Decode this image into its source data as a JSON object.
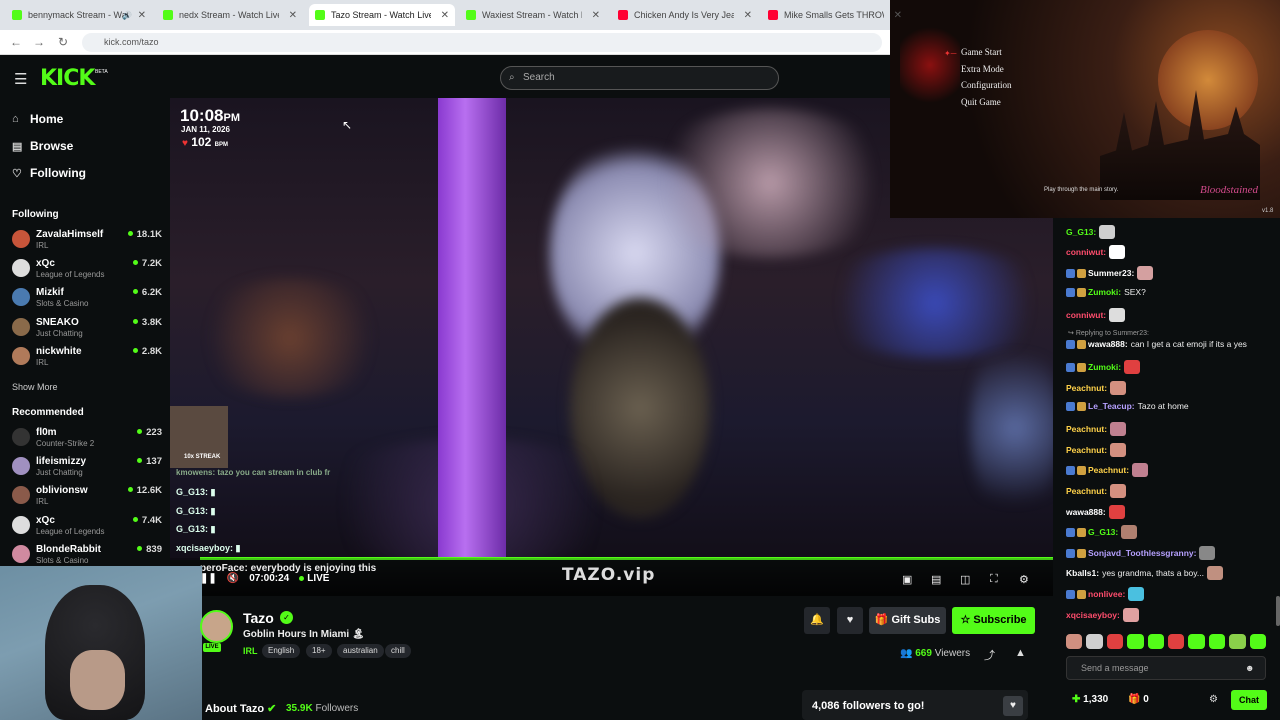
{
  "browser": {
    "tabs": [
      {
        "title": "bennymack Stream - Watch Live on",
        "color": "#53fc18",
        "active": false,
        "muted": true
      },
      {
        "title": "nedx Stream - Watch Live on Kick",
        "color": "#53fc18",
        "active": false
      },
      {
        "title": "Tazo Stream - Watch Live on Kick",
        "color": "#53fc18",
        "active": true
      },
      {
        "title": "Waxiest Stream - Watch Live on Kick",
        "color": "#53fc18",
        "active": false
      },
      {
        "title": "Chicken Andy Is Very Jealous",
        "color": "#ff0033",
        "active": false
      },
      {
        "title": "Mike Smalls Gets THROWN",
        "color": "#ff0033",
        "active": false
      }
    ],
    "url": "kick.com/tazo"
  },
  "header": {
    "logo": "KICK",
    "beta": "BETA",
    "search_placeholder": "Search"
  },
  "sidebar": {
    "nav": [
      {
        "label": "Home",
        "icon": "home-icon"
      },
      {
        "label": "Browse",
        "icon": "browse-icon"
      },
      {
        "label": "Following",
        "icon": "heart-icon"
      }
    ],
    "following_title": "Following",
    "following": [
      {
        "name": "ZavalaHimself",
        "category": "IRL",
        "viewers": "18.1K",
        "color": "#c7553a"
      },
      {
        "name": "xQc",
        "category": "League of Legends",
        "viewers": "7.2K",
        "color": "#dddddd"
      },
      {
        "name": "Mizkif",
        "category": "Slots & Casino",
        "viewers": "6.2K",
        "color": "#4a7ab0"
      },
      {
        "name": "SNEAKO",
        "category": "Just Chatting",
        "viewers": "3.8K",
        "color": "#8a6a4a"
      },
      {
        "name": "nickwhite",
        "category": "IRL",
        "viewers": "2.8K",
        "color": "#b07a5a"
      }
    ],
    "show_more": "Show More",
    "recommended_title": "Recommended",
    "recommended": [
      {
        "name": "fl0m",
        "category": "Counter-Strike 2",
        "viewers": "223",
        "color": "#333333"
      },
      {
        "name": "lifeismizzy",
        "category": "Just Chatting",
        "viewers": "137",
        "color": "#a090c0"
      },
      {
        "name": "oblivionsw",
        "category": "IRL",
        "viewers": "12.6K",
        "color": "#8a5a4a"
      },
      {
        "name": "xQc",
        "category": "League of Legends",
        "viewers": "7.4K",
        "color": "#dddddd"
      },
      {
        "name": "BlondeRabbit",
        "category": "Slots & Casino",
        "viewers": "839",
        "color": "#d08aa0"
      }
    ]
  },
  "video": {
    "clock": "10:08",
    "ampm": "PM",
    "date": "JAN 11, 2026",
    "bpm": "102",
    "bpm_unit": "BPM",
    "streak": "10x STREAK",
    "overlay_chat": [
      {
        "text": "kmowens: tazo you can stream in club fr"
      },
      {
        "text": "G_G13: ▮"
      },
      {
        "text": "G_G13: ▮"
      },
      {
        "text": "G_G13: ▮"
      },
      {
        "text": "xqcisaeyboy: ▮"
      }
    ],
    "caption": "peroFace: everybody is enjoying this",
    "time": "07:00:24",
    "live": "LIVE",
    "watermark": "TAZO.vip"
  },
  "channel": {
    "name": "Tazo",
    "live_badge": "LIVE",
    "title": "Goblin Hours In Miami 🏝",
    "category": "IRL",
    "tags": [
      "English",
      "18+",
      "australian",
      "chill"
    ],
    "gift_label": "Gift Subs",
    "subscribe_label": "Subscribe",
    "viewers": "669",
    "viewers_label": "Viewers",
    "about_label": "About Tazo",
    "followers": "35.9K",
    "followers_label": "Followers",
    "goal_text": "4,086 followers to go!"
  },
  "game": {
    "menu": [
      "Game Start",
      "Extra Mode",
      "Configuration",
      "Quit Game"
    ],
    "hint": "Play through the main story.",
    "logo": "Bloodstained",
    "version": "v1.8"
  },
  "chat": {
    "reply_text": "Replying to Summer23:",
    "messages": [
      {
        "user": "G_G13:",
        "color": "#53fc18",
        "text": "",
        "emote": "#cfcfcf"
      },
      {
        "user": "conniwut:",
        "color": "#ff4d6d",
        "text": "",
        "emote": "#ffffff"
      },
      {
        "user": "Summer23:",
        "color": "#ffffff",
        "text": "",
        "emote": "#d4a0a0"
      },
      {
        "user": "Zumoki:",
        "color": "#53fc18",
        "text": "SEX?",
        "emote": ""
      },
      {
        "user": "conniwut:",
        "color": "#ff4d6d",
        "text": "",
        "emote": "#dddddd"
      },
      {
        "user": "wawa888:",
        "color": "#ffffff",
        "text": "can I get a cat emoji if its a yes",
        "emote": ""
      },
      {
        "user": "Zumoki:",
        "color": "#53fc18",
        "text": "",
        "emote": "#e04040"
      },
      {
        "user": "Peachnut:",
        "color": "#ffd24a",
        "text": "",
        "emote": "#d49080"
      },
      {
        "user": "Le_Teacup:",
        "color": "#b6a0ff",
        "text": "Tazo at home",
        "emote": ""
      },
      {
        "user": "Peachnut:",
        "color": "#ffd24a",
        "text": "",
        "emote": "#c08090"
      },
      {
        "user": "Peachnut:",
        "color": "#ffd24a",
        "text": "",
        "emote": "#d49080"
      },
      {
        "user": "Peachnut:",
        "color": "#ffd24a",
        "text": "",
        "emote": "#c08090"
      },
      {
        "user": "Peachnut:",
        "color": "#ffd24a",
        "text": "",
        "emote": "#d49080"
      },
      {
        "user": "wawa888:",
        "color": "#ffffff",
        "text": "",
        "emote": "#e04040"
      },
      {
        "user": "G_G13:",
        "color": "#53fc18",
        "text": "",
        "emote": "#b08070"
      },
      {
        "user": "Sonjavd_Toothlessgranny:",
        "color": "#b6a0ff",
        "text": "",
        "emote": "#888888"
      },
      {
        "user": "Kballs1:",
        "color": "#ffffff",
        "text": "yes grandma, thats a boy...",
        "emote": "#c09080"
      },
      {
        "user": "nonlivee:",
        "color": "#ff4d6d",
        "text": "",
        "emote": "#4ac0e0"
      },
      {
        "user": "xqcisaeyboy:",
        "color": "#ff4d6d",
        "text": "",
        "emote": "#e0a0a0"
      }
    ],
    "input_placeholder": "Send a message",
    "points": "1,330",
    "gifts": "0",
    "chat_button": "Chat"
  }
}
